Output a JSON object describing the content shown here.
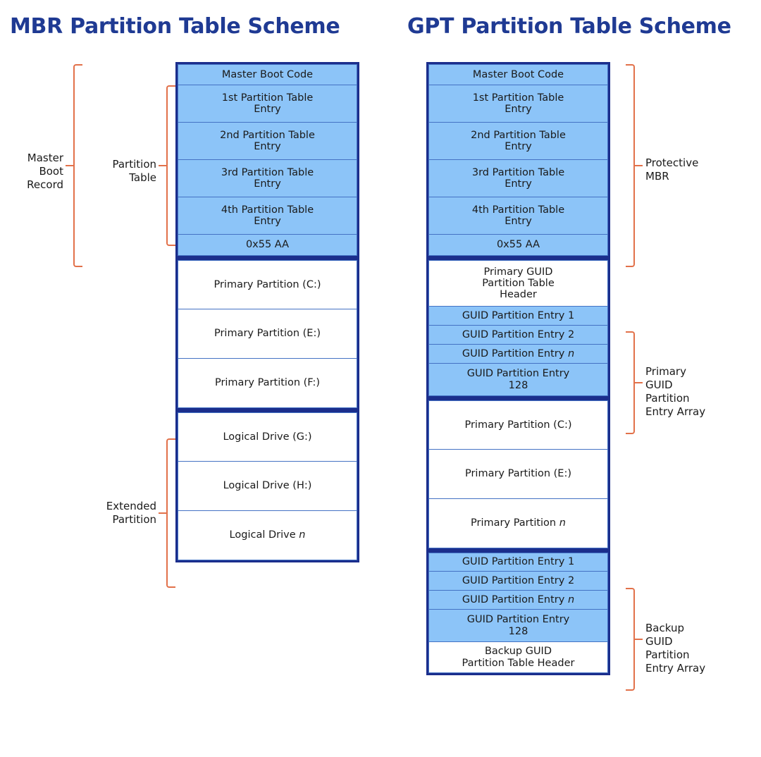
{
  "mbr": {
    "title": "MBR Partition Table Scheme",
    "rows": [
      {
        "label": "Master Boot Code",
        "fill": "blue"
      },
      {
        "label": "1st Partition Table Entry",
        "fill": "blue"
      },
      {
        "label": "2nd Partition Table Entry",
        "fill": "blue"
      },
      {
        "label": "3rd Partition Table Entry",
        "fill": "blue"
      },
      {
        "label": "4th Partition Table Entry",
        "fill": "blue"
      },
      {
        "label": "0x55 AA",
        "fill": "blue"
      },
      {
        "label": "Primary Partition (C:)",
        "fill": "white"
      },
      {
        "label": "Primary Partition (E:)",
        "fill": "white"
      },
      {
        "label": "Primary Partition (F:)",
        "fill": "white"
      },
      {
        "label": "Logical Drive (G:)",
        "fill": "white"
      },
      {
        "label": "Logical Drive (H:)",
        "fill": "white"
      },
      {
        "label": "Logical Drive n",
        "fill": "white",
        "italic_tail": "n"
      }
    ],
    "brackets": [
      {
        "name": "master-boot-record",
        "label": "Master\nBoot\nRecord"
      },
      {
        "name": "partition-table",
        "label": "Partition\nTable"
      },
      {
        "name": "extended-partition",
        "label": "Extended\nPartition"
      }
    ]
  },
  "gpt": {
    "title": "GPT Partition Table Scheme",
    "rows": [
      {
        "label": "Master Boot Code",
        "fill": "blue"
      },
      {
        "label": "1st Partition Table Entry",
        "fill": "blue"
      },
      {
        "label": "2nd Partition Table Entry",
        "fill": "blue"
      },
      {
        "label": "3rd Partition Table Entry",
        "fill": "blue"
      },
      {
        "label": "4th Partition Table Entry",
        "fill": "blue"
      },
      {
        "label": "0x55 AA",
        "fill": "blue"
      },
      {
        "label": "Primary GUID Partition Table Header",
        "fill": "white"
      },
      {
        "label": "GUID Partition Entry 1",
        "fill": "blue"
      },
      {
        "label": "GUID Partition Entry 2",
        "fill": "blue"
      },
      {
        "label": "GUID Partition Entry n",
        "fill": "blue",
        "italic_tail": "n"
      },
      {
        "label": "GUID Partition Entry 128",
        "fill": "blue"
      },
      {
        "label": "Primary Partition (C:)",
        "fill": "white"
      },
      {
        "label": "Primary Partition (E:)",
        "fill": "white"
      },
      {
        "label": "Primary Partition n",
        "fill": "white",
        "italic_tail": "n"
      },
      {
        "label": "GUID Partition Entry 1",
        "fill": "blue"
      },
      {
        "label": "GUID Partition Entry 2",
        "fill": "blue"
      },
      {
        "label": "GUID Partition Entry n",
        "fill": "blue",
        "italic_tail": "n"
      },
      {
        "label": "GUID Partition Entry 128",
        "fill": "blue"
      },
      {
        "label": "Backup GUID Partition Table Header",
        "fill": "white"
      }
    ],
    "brackets": [
      {
        "name": "protective-mbr",
        "label": "Protective\nMBR"
      },
      {
        "name": "primary-guid-partition-entry-array",
        "label": "Primary\nGUID\nPartition\nEntry Array"
      },
      {
        "name": "backup-guid-partition-entry-array",
        "label": "Backup\nGUID\nPartition\nEntry Array"
      }
    ]
  },
  "colors": {
    "title": "#1F3A93",
    "cell_fill": "#8CC4F8",
    "cell_border": "#4472C4",
    "group_border": "#1B2E8C",
    "bracket": "#E2714A",
    "background": "#FFFFFF"
  },
  "rowtext": {
    "mbc": "Master Boot Code",
    "pte1a": "1st Partition Table",
    "pte1b": "Entry",
    "pte2a": "2nd Partition Table",
    "pte2b": "Entry",
    "pte3a": "3rd Partition Table",
    "pte3b": "Entry",
    "pte4a": "4th Partition Table",
    "pte4b": "Entry",
    "sig": "0x55 AA",
    "pp_c": "Primary Partition (C:)",
    "pp_e": "Primary Partition (E:)",
    "pp_f": "Primary Partition (F:)",
    "ld_g": "Logical Drive (G:)",
    "ld_h": "Logical Drive (H:)",
    "ld_n_pre": "Logical Drive ",
    "ld_n_it": "n",
    "pgpth_a": "Primary GUID",
    "pgpth_b": "Partition Table",
    "pgpth_c": "Header",
    "gpe1": "GUID Partition Entry 1",
    "gpe2": "GUID Partition Entry 2",
    "gpen_pre": "GUID Partition Entry ",
    "gpen_it": "n",
    "gpe128_a": "GUID Partition Entry",
    "gpe128_b": "128",
    "pp_n_pre": "Primary Partition ",
    "pp_n_it": "n",
    "bgpth_a": "Backup GUID",
    "bgpth_b": "Partition Table Header"
  },
  "labels": {
    "master_boot_record": "Master\nBoot\nRecord",
    "partition_table": "Partition\nTable",
    "extended_partition": "Extended\nPartition",
    "protective_mbr": "Protective\nMBR",
    "primary_array": "Primary\nGUID\nPartition\nEntry Array",
    "backup_array": "Backup\nGUID\nPartition\nEntry Array"
  }
}
